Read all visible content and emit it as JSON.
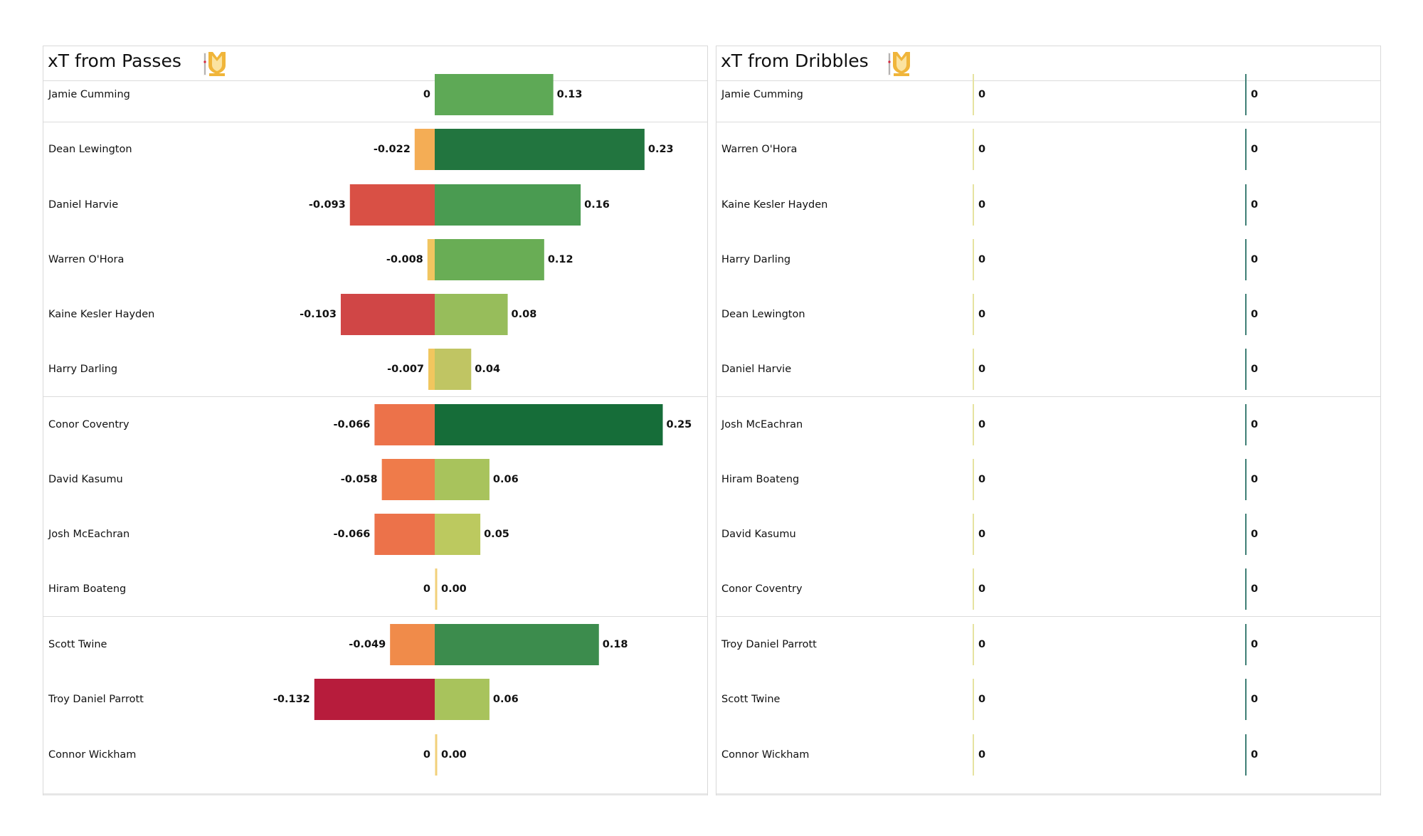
{
  "chart_data": [
    {
      "type": "bar",
      "orientation": "horizontal-diverging",
      "title": "xT from Passes",
      "xlabel": "",
      "ylabel": "",
      "categories": [
        "Jamie Cumming",
        "Dean Lewington",
        "Daniel Harvie",
        "Warren O'Hora",
        "Kaine Kesler Hayden",
        "Harry Darling",
        "Conor Coventry",
        "David Kasumu",
        "Josh McEachran",
        "Hiram Boateng",
        "Scott Twine",
        "Troy Daniel Parrott",
        "Connor Wickham"
      ],
      "groups": [
        [
          0
        ],
        [
          1,
          2,
          3,
          4,
          5
        ],
        [
          6,
          7,
          8,
          9
        ],
        [
          10,
          11,
          12
        ]
      ],
      "series": [
        {
          "name": "negative xT",
          "values": [
            0,
            -0.022,
            -0.093,
            -0.008,
            -0.103,
            -0.007,
            -0.066,
            -0.058,
            -0.066,
            0,
            -0.049,
            -0.132,
            0
          ],
          "labels": [
            "0",
            "-0.022",
            "-0.093",
            "-0.008",
            "-0.103",
            "-0.007",
            "-0.066",
            "-0.058",
            "-0.066",
            "0",
            "-0.049",
            "-0.132",
            "0"
          ],
          "colors": [
            "#f2d07a",
            "#f4ad55",
            "#d95045",
            "#f1c560",
            "#d04646",
            "#f1c65e",
            "#ec724a",
            "#ef7b4a",
            "#ec724a",
            "#f2d07a",
            "#f08b4a",
            "#b71c3c",
            "#f2d07a"
          ]
        },
        {
          "name": "positive xT",
          "values": [
            0.13,
            0.23,
            0.16,
            0.12,
            0.08,
            0.04,
            0.25,
            0.06,
            0.05,
            0.0,
            0.18,
            0.06,
            0.0
          ],
          "labels": [
            "0.13",
            "0.23",
            "0.16",
            "0.12",
            "0.08",
            "0.04",
            "0.25",
            "0.06",
            "0.05",
            "0.00",
            "0.18",
            "0.06",
            "0.00"
          ],
          "colors": [
            "#5ea956",
            "#22753f",
            "#4a9b51",
            "#69ad55",
            "#97bd5b",
            "#c0c563",
            "#166d39",
            "#a8c35c",
            "#bcc95f",
            "#f2d07a",
            "#3c8c4d",
            "#a8c35c",
            "#f2d07a"
          ]
        }
      ],
      "xlim": [
        -0.15,
        0.27
      ]
    },
    {
      "type": "bar",
      "orientation": "horizontal-diverging",
      "title": "xT from Dribbles",
      "xlabel": "",
      "ylabel": "",
      "categories": [
        "Jamie Cumming",
        "Warren O'Hora",
        "Kaine Kesler Hayden",
        "Harry Darling",
        "Dean Lewington",
        "Daniel Harvie",
        "Josh McEachran",
        "Hiram Boateng",
        "David Kasumu",
        "Conor Coventry",
        "Troy Daniel Parrott",
        "Scott Twine",
        "Connor Wickham"
      ],
      "groups": [
        [
          0
        ],
        [
          1,
          2,
          3,
          4,
          5
        ],
        [
          6,
          7,
          8,
          9
        ],
        [
          10,
          11,
          12
        ]
      ],
      "series": [
        {
          "name": "negative xT",
          "values": [
            0,
            0,
            0,
            0,
            0,
            0,
            0,
            0,
            0,
            0,
            0,
            0,
            0
          ],
          "labels": [
            "0",
            "0",
            "0",
            "0",
            "0",
            "0",
            "0",
            "0",
            "0",
            "0",
            "0",
            "0",
            "0"
          ],
          "color": "#e6e3a0"
        },
        {
          "name": "positive xT",
          "values": [
            0,
            0,
            0,
            0,
            0,
            0,
            0,
            0,
            0,
            0,
            0,
            0,
            0
          ],
          "labels": [
            "0",
            "0",
            "0",
            "0",
            "0",
            "0",
            "0",
            "0",
            "0",
            "0",
            "0",
            "0",
            "0"
          ],
          "color": "#3f7f75"
        }
      ]
    }
  ],
  "panels": [
    {
      "title": "xT from Passes",
      "logo": "mk-dons-crest-icon"
    },
    {
      "title": "xT from Dribbles",
      "logo": "mk-dons-crest-icon"
    }
  ]
}
